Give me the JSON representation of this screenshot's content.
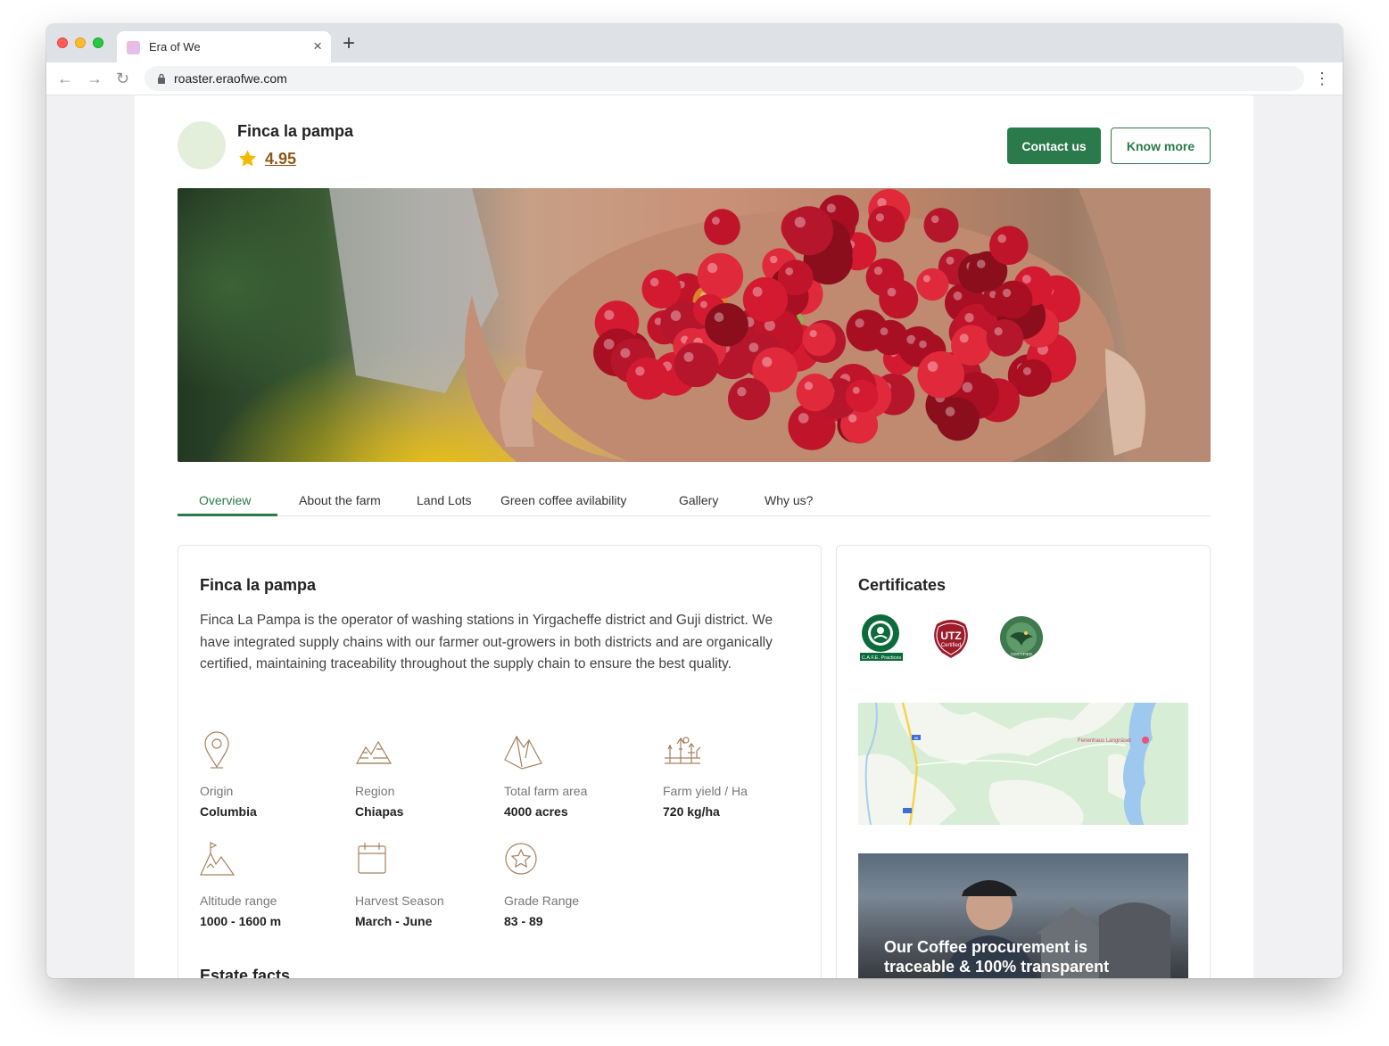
{
  "browser": {
    "tab_title": "Era of We",
    "url": "roaster.eraofwe.com"
  },
  "header": {
    "farm_name": "Finca la pampa",
    "rating": "4.95",
    "contact_label": "Contact us",
    "know_more_label": "Know more"
  },
  "tabs": [
    {
      "label": "Overview",
      "active": true
    },
    {
      "label": "About the farm"
    },
    {
      "label": "Land Lots"
    },
    {
      "label": "Green coffee avilability"
    },
    {
      "label": "Gallery"
    },
    {
      "label": "Why us?"
    }
  ],
  "overview": {
    "title": "Finca la pampa",
    "description": "Finca La Pampa is the operator of washing stations in Yirgacheffe district and Guji district. We have integrated supply chains with our farmer out-growers in both districts and are organically certified, maintaining traceability throughout the supply chain to ensure the best quality.",
    "facts": [
      {
        "icon": "location-pin-icon",
        "label": "Origin",
        "value": "Columbia"
      },
      {
        "icon": "region-icon",
        "label": "Region",
        "value": "Chiapas"
      },
      {
        "icon": "mountain-icon",
        "label": "Total farm area",
        "value": "4000 acres"
      },
      {
        "icon": "crop-icon",
        "label": "Farm yield / Ha",
        "value": "720 kg/ha"
      },
      {
        "icon": "summit-flag-icon",
        "label": "Altitude range",
        "value": "1000 - 1600 m"
      },
      {
        "icon": "calendar-icon",
        "label": "Harvest Season",
        "value": "March - June"
      },
      {
        "icon": "star-badge-icon",
        "label": "Grade Range",
        "value": "83 - 89"
      }
    ],
    "estate_facts_title": "Estate facts"
  },
  "sidebar": {
    "certificates_title": "Certificates",
    "certificates": [
      {
        "name": "starbucks-cafe-practices-logo",
        "caption": "C.A.F.E. Practices"
      },
      {
        "name": "utz-certified-logo",
        "line1": "UTZ",
        "line2": "Certified"
      },
      {
        "name": "rainforest-alliance-logo",
        "caption": "CERTIFIED"
      }
    ],
    "map_label": "Ferienhaus Langnäset",
    "road_label": "86",
    "promo_line1": "Our Coffee procurement is",
    "promo_line2": "traceable & 100%  transparent"
  },
  "colors": {
    "brand_green": "#2a7a4b",
    "rating_brown": "#8b5a1b",
    "star_yellow": "#f5b800",
    "icon_brown": "#a4825f"
  }
}
